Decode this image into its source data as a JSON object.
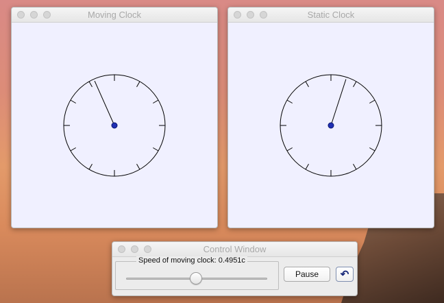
{
  "windows": [
    {
      "title": "Moving Clock",
      "hand_minutes": 56
    },
    {
      "title": "Static Clock",
      "hand_minutes": 3
    }
  ],
  "control": {
    "title": "Control Window",
    "speed_label": "Speed of moving clock: 0.4951c",
    "speed_fraction": 0.4951,
    "pause_label": "Pause",
    "reset_icon": "undo-icon",
    "reset_glyph": "↶"
  },
  "colors": {
    "clock_face": "#f0f0ff",
    "center_dot": "#1f2fb3"
  }
}
